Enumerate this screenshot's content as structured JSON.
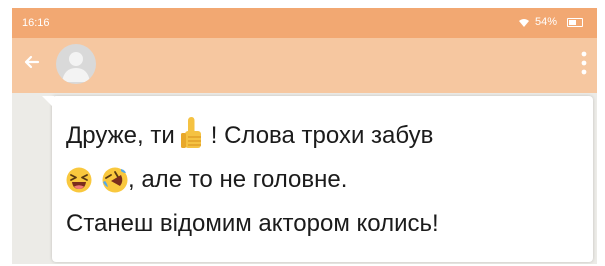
{
  "status_bar": {
    "time": "16:16",
    "battery": "54%",
    "color": "#f2a872"
  },
  "app_bar": {
    "color": "#f6c7a0",
    "icons": [
      "back-arrow-icon",
      "avatar",
      "more-vert-icon"
    ]
  },
  "message": {
    "line1_part1": "Друже, ти",
    "line1_part2": "! Слова трохи забув",
    "line2": ", але то не головне.",
    "line3": "Станеш відомим актором колись!",
    "emojis": [
      "thumbs-up",
      "laughing-face",
      "rolling-laughing-face"
    ]
  }
}
